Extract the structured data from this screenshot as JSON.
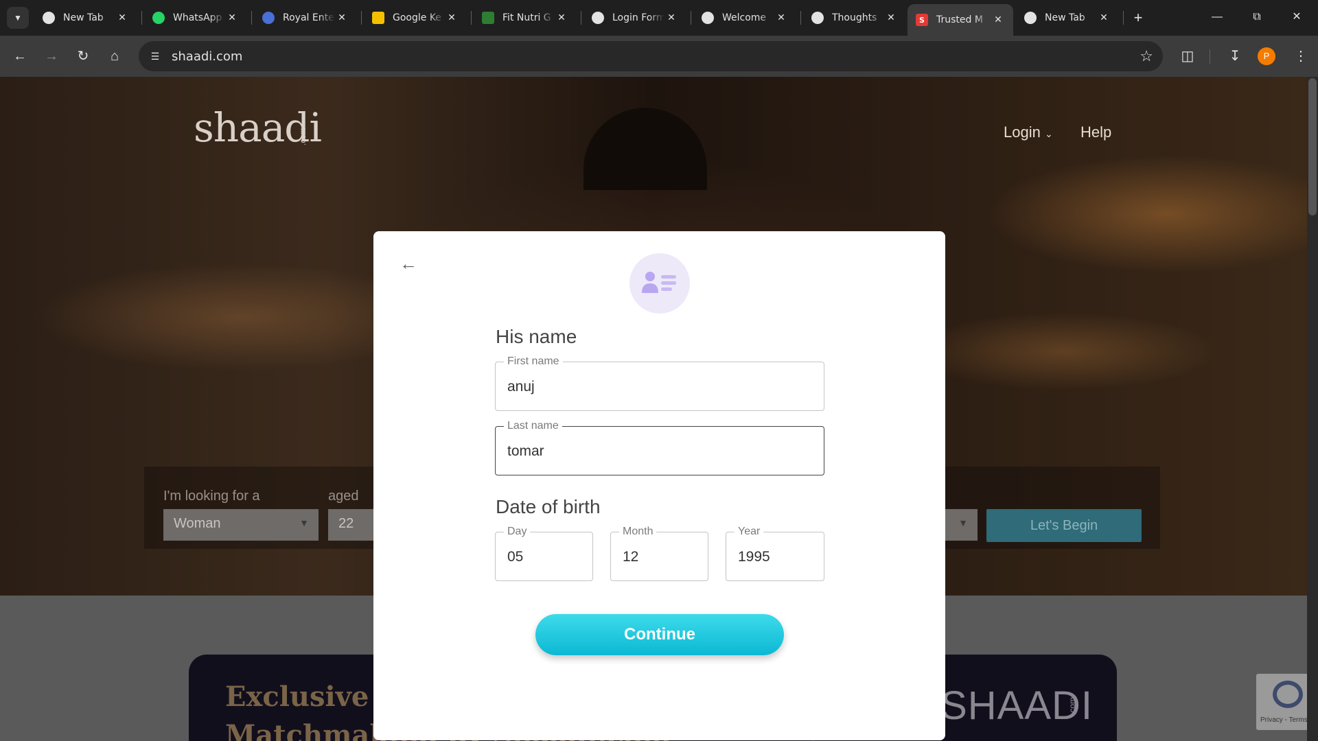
{
  "browser": {
    "tabs": [
      {
        "title": "New Tab",
        "icon": "chrome-icon",
        "color": "#e3e3e3"
      },
      {
        "title": "WhatsApp",
        "icon": "whatsapp-icon",
        "color": "#25d366"
      },
      {
        "title": "Royal Ente",
        "icon": "royal-icon",
        "color": "#4a6fd6"
      },
      {
        "title": "Google Ke",
        "icon": "keep-icon",
        "color": "#f6c000"
      },
      {
        "title": "Fit Nutri G",
        "icon": "fitnutri-icon",
        "color": "#2e7d32"
      },
      {
        "title": "Login Form",
        "icon": "globe-icon",
        "color": "#e3e3e3"
      },
      {
        "title": "Welcome",
        "icon": "globe-icon",
        "color": "#e3e3e3"
      },
      {
        "title": "Thoughts",
        "icon": "openai-icon",
        "color": "#e3e3e3"
      },
      {
        "title": "Trusted M",
        "icon": "shaadi-icon",
        "color": "#e53935",
        "active": true
      },
      {
        "title": "New Tab",
        "icon": "chrome-icon",
        "color": "#e3e3e3"
      }
    ],
    "url": "shaadi.com",
    "profile_initial": "P"
  },
  "site": {
    "logo": "shaadi",
    "logo_suffix": ".com",
    "nav": {
      "login": "Login",
      "help": "Help"
    },
    "search": {
      "looking_for_label": "I'm looking for a",
      "looking_for_value": "Woman",
      "aged_label": "aged",
      "aged_value": "22",
      "begin_button": "Let's Begin"
    },
    "vip_banner": {
      "text": "Exclusive & Personalised Matchmaking by Shaadi.com",
      "logo": "VIPSHAADI",
      "logo_suffix": ".com"
    },
    "recaptcha": "Privacy - Terms"
  },
  "modal": {
    "name_section": "His name",
    "first_name": {
      "label": "First name",
      "value": "anuj"
    },
    "last_name": {
      "label": "Last name",
      "value": "tomar"
    },
    "dob_section": "Date of birth",
    "day": {
      "label": "Day",
      "value": "05"
    },
    "month": {
      "label": "Month",
      "value": "12"
    },
    "year": {
      "label": "Year",
      "value": "1995"
    },
    "continue_button": "Continue"
  },
  "colors": {
    "accent": "#1ec8df",
    "avatar_bg": "#ede9f8",
    "avatar_icon": "#b9a6f0"
  }
}
